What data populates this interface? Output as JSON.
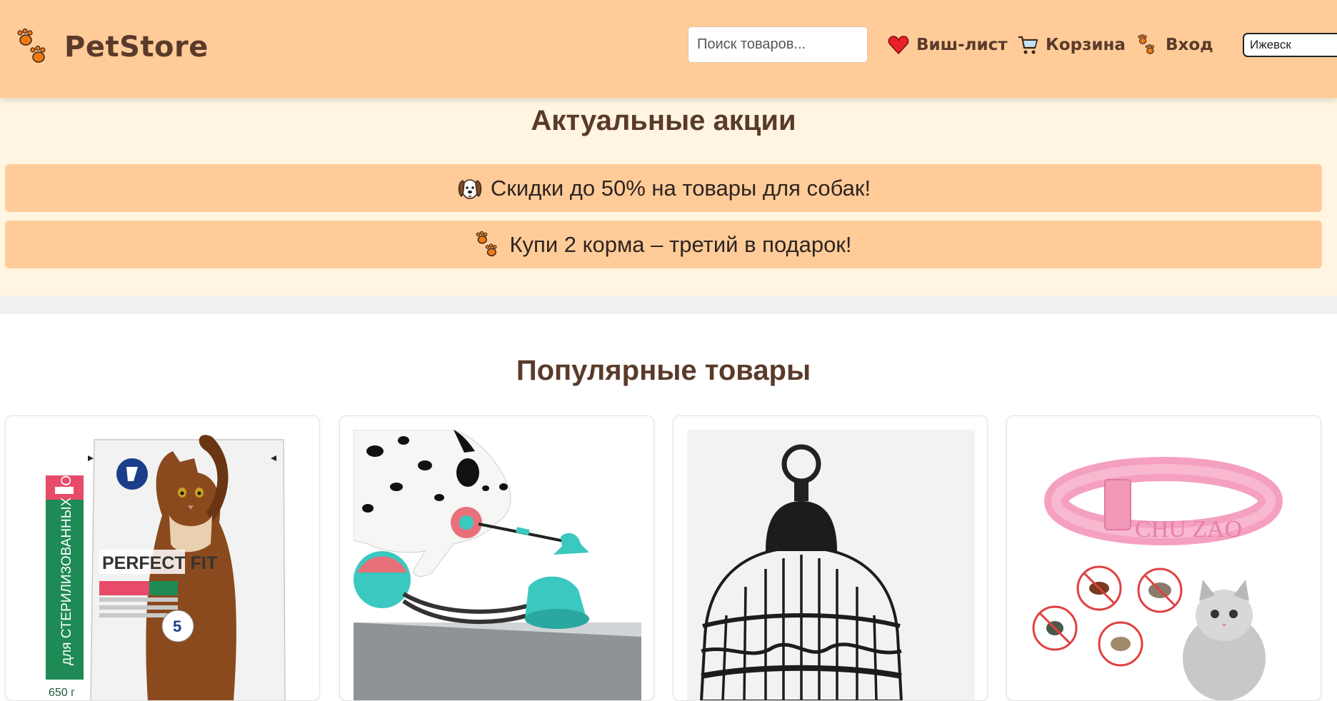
{
  "header": {
    "logo_text": "PetStore",
    "search_placeholder": "Поиск товаров...",
    "nav": {
      "wishlist": "Виш-лист",
      "cart": "Корзина",
      "login": "Вход"
    },
    "city": "Ижевск"
  },
  "promo": {
    "title": "Актуальные акции",
    "banners": [
      {
        "icon": "dog-icon",
        "text": "Скидки до 50% на товары для собак!"
      },
      {
        "icon": "paw-icon",
        "text": "Купи 2 корма – третий в подарок!"
      }
    ]
  },
  "popular": {
    "title": "Популярные товары",
    "products": [
      {
        "image": "cat-food-pack-image",
        "package_brand": "PERFECT FIT",
        "package_side": "для СТЕРИЛИЗОВАННЫХ КОШЕК",
        "package_weight": "650 г",
        "package_badge": "5"
      },
      {
        "image": "dog-toy-image"
      },
      {
        "image": "bird-cage-image"
      },
      {
        "image": "flea-collar-image",
        "collar_text": "CHU ZAO"
      }
    ]
  },
  "colors": {
    "header_bg": "#ffcc99",
    "promo_bg": "#fff5e0",
    "banner_bg": "#ffcc99",
    "title_text": "#5a3a2a",
    "paw_orange": "#f07a12"
  }
}
